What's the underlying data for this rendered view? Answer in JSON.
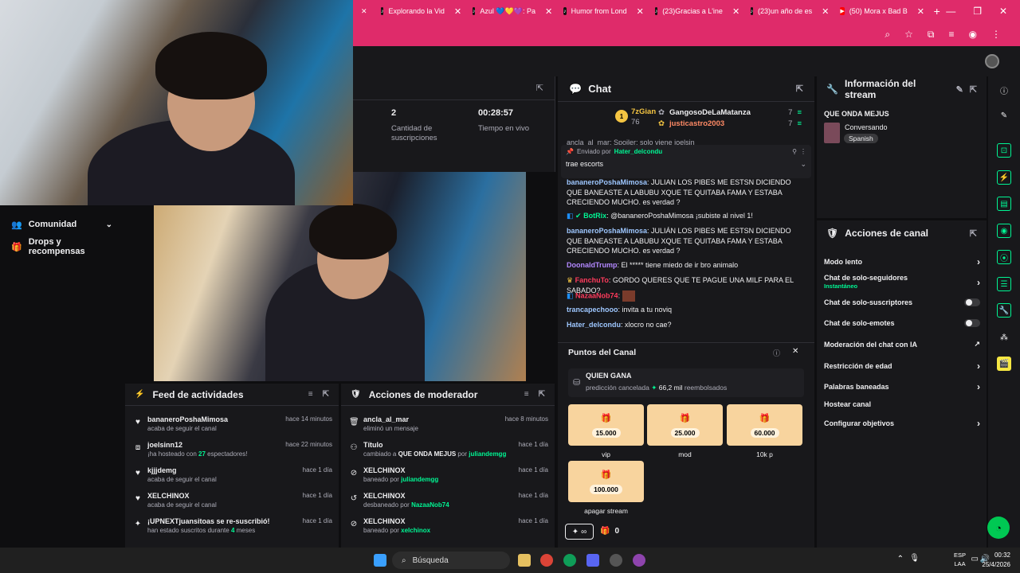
{
  "browser": {
    "tabs": [
      {
        "title": "Explorando la Vid"
      },
      {
        "title": "Azul 💙💛💜: Pa"
      },
      {
        "title": "Humor from Lond"
      },
      {
        "title": "(23)Gracias a L'ine"
      },
      {
        "title": "(23)un año de es"
      },
      {
        "title": "(50) Mora x Bad B"
      }
    ],
    "new_tab": "+"
  },
  "sidebar": {
    "items": [
      {
        "label": "Comunidad"
      },
      {
        "label": "Drops y recompensas"
      }
    ]
  },
  "stats": {
    "subs_value": "2",
    "subs_label": "Cantidad de suscripciones",
    "time_value": "00:28:57",
    "time_label": "Tiempo en vivo"
  },
  "chat": {
    "title": "Chat",
    "leaders": [
      {
        "rank": "1",
        "name": "7zGian",
        "count": "76"
      },
      {
        "name": "GangosoDeLaMatanza",
        "count": "7"
      },
      {
        "name": "justicastro2003",
        "count": "7"
      }
    ],
    "partial_message": "ancla_al_mar: Spoiler: solo viene joelsin",
    "pinned": {
      "label": "Enviado por",
      "user": "Hater_delcondu",
      "text": "trae escorts"
    },
    "messages": [
      {
        "user": "bananeroPoshaMimosa",
        "text": ": JULIAN LOS PIBES ME ESTSN DICIENDO QUE BANEASTE A LABUBU XQUE TE QUITABA FAMA Y ESTABA CRECIENDO MUCHO. es verdad ?",
        "color": "#9ec7ff"
      },
      {
        "user": "BotRix",
        "text": ": @bananeroPoshaMimosa ¡subiste al nivel 1!",
        "color": "#00f593"
      },
      {
        "user": "bananeroPoshaMimosa",
        "text": ": JULIÁN LOS PIBES ME ESTSN DICIENDO QUE BANEASTE A LABUBU XQUE TE QUITABA FAMA Y ESTABA CRECIENDO MUCHO. es verdad ?",
        "color": "#9ec7ff"
      },
      {
        "user": "DoonaldTrump",
        "text": ": El ***** tiene miedo de ir bro animalo",
        "color": "#b388ff"
      },
      {
        "user": "FanchuTo",
        "text": ": GORDO QUERES QUE TE PAGUE UNA MILF PARA EL SABADO?",
        "color": "#ff3b5c"
      },
      {
        "user": "NazaaNob74",
        "text": ":",
        "color": "#ff3b5c"
      },
      {
        "user": "trancapechooo",
        "text": ": invita a tu noviq",
        "color": "#9ec7ff"
      },
      {
        "user": "Hater_delcondu",
        "text": ": xlocro no cae?",
        "color": "#9ec7ff"
      }
    ]
  },
  "points": {
    "title": "Puntos del Canal",
    "prediction_title": "QUIEN GANA",
    "prediction_status": "predicción cancelada",
    "prediction_amount": "66,2 mil",
    "prediction_suffix": "reembolsados",
    "rewards": [
      {
        "value": "15.000",
        "label": "vip"
      },
      {
        "value": "25.000",
        "label": "mod"
      },
      {
        "value": "60.000",
        "label": "10k p"
      },
      {
        "value": "100.000",
        "label": "apagar stream"
      }
    ],
    "balance": "0",
    "infinity": "∞"
  },
  "info": {
    "title": "Información del stream",
    "stream_title": "QUE ONDA MEJUS",
    "category": "Conversando",
    "language": "Spanish"
  },
  "actions": {
    "title": "Acciones de canal",
    "items": [
      {
        "label": "Modo lento",
        "control": "arrow"
      },
      {
        "label": "Chat de solo-seguidores",
        "sub": "Instantáneo",
        "control": "arrow"
      },
      {
        "label": "Chat de solo-suscriptores",
        "control": "toggle"
      },
      {
        "label": "Chat de solo-emotes",
        "control": "toggle"
      },
      {
        "label": "Moderación del chat con IA",
        "control": "external"
      },
      {
        "label": "Restricción de edad",
        "control": "arrow"
      },
      {
        "label": "Palabras baneadas",
        "control": "arrow"
      },
      {
        "label": "Hostear canal",
        "control": "none"
      },
      {
        "label": "Configurar objetivos",
        "control": "arrow"
      }
    ]
  },
  "feed": {
    "title": "Feed de actividades",
    "items": [
      {
        "name": "bananeroPoshaMimosa",
        "time": "hace 14 minutos",
        "desc": "acaba de seguir el canal",
        "icon": "heart-icon"
      },
      {
        "name": "joelsinn12",
        "time": "hace 22 minutos",
        "desc_pre": "¡ha hosteado con ",
        "desc_hl": "27",
        "desc_post": " espectadores!",
        "icon": "host-icon"
      },
      {
        "name": "kjjjdemg",
        "time": "hace 1 día",
        "desc": "acaba de seguir el canal",
        "icon": "heart-icon"
      },
      {
        "name": "XELCHINOX",
        "time": "hace 1 día",
        "desc": "acaba de seguir el canal",
        "icon": "heart-icon"
      },
      {
        "name": "¡UPNEXTjuansitoas se re-suscribió!",
        "time": "hace 1 día",
        "desc_pre": "han estado suscritos durante ",
        "desc_hl": "4",
        "desc_post": " meses",
        "icon": "star-icon"
      }
    ]
  },
  "mod": {
    "title": "Acciones de moderador",
    "items": [
      {
        "name": "ancla_al_mar",
        "time": "hace 8 minutos",
        "desc_pre": "eliminó un mensaje",
        "icon": "trash-icon"
      },
      {
        "name": "Título",
        "time": "hace 1 día",
        "desc_pre": "cambiado a ",
        "desc_wh": "QUE ONDA MEJUS",
        "desc_mid": " por ",
        "desc_hl": "juliandemgg",
        "icon": "users-icon"
      },
      {
        "name": "XELCHINOX",
        "time": "hace 1 día",
        "desc_pre": "baneado por ",
        "desc_hl": "juliandemgg",
        "icon": "ban-icon"
      },
      {
        "name": "XELCHINOX",
        "time": "hace 1 día",
        "desc_pre": "desbaneado por ",
        "desc_hl": "NazaaNob74",
        "icon": "undo-icon"
      },
      {
        "name": "XELCHINOX",
        "time": "hace 1 día",
        "desc_pre": "baneado por ",
        "desc_hl": "xelchinox",
        "icon": "ban-icon"
      }
    ]
  },
  "taskbar": {
    "search": "Búsqueda",
    "lang_line1": "ESP",
    "lang_line2": "LAA",
    "time": "00:32",
    "date": "25/4/2026"
  },
  "colors": {
    "accent_green": "#00f593",
    "browser_pink": "#df2b6a",
    "reward_bg": "#f8d49e"
  }
}
